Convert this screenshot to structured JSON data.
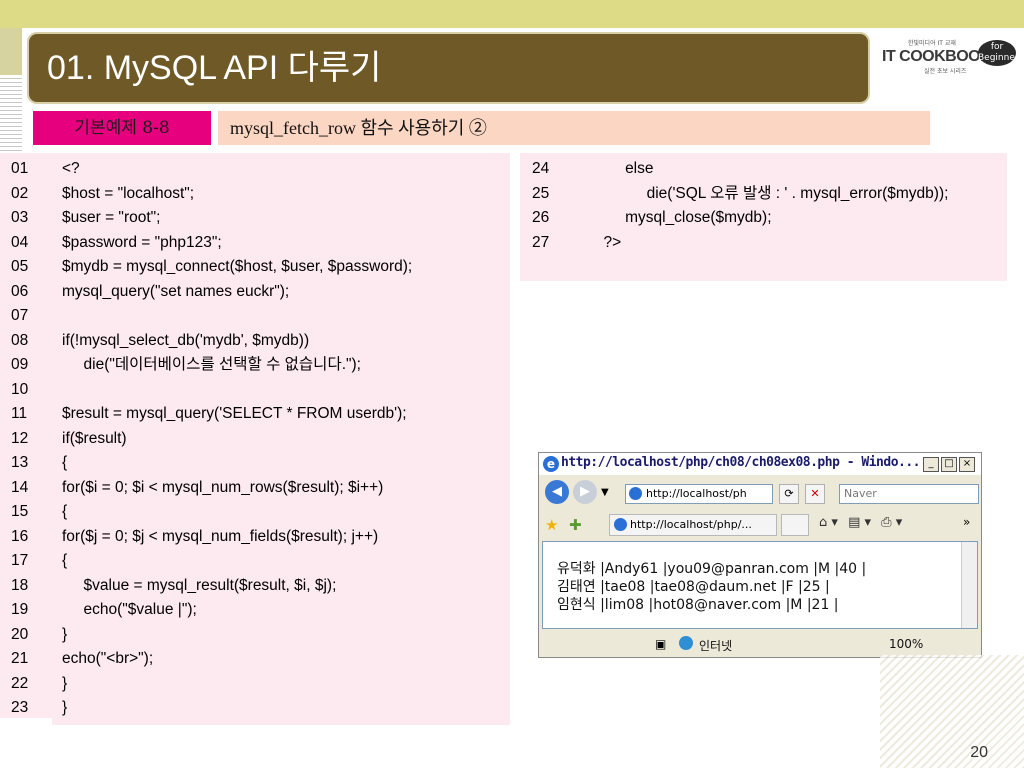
{
  "slide": {
    "title": "01.  MySQL API  다루기",
    "page_number": "20",
    "example_tag": "기본예제 8-8",
    "example_title": "mysql_fetch_row 함수 사용하기 ②"
  },
  "logo": {
    "main": "IT COOKBOOK",
    "small_top": "한빛미디어 IT 교재",
    "small_bottom": "실전 초보 시리즈",
    "badge": "for Beginner"
  },
  "code_left": [
    {
      "n": "01",
      "t": "<?"
    },
    {
      "n": "02",
      "t": "$host = \"localhost\";"
    },
    {
      "n": "03",
      "t": "$user = \"root\";"
    },
    {
      "n": "04",
      "t": "$password = \"php123\";"
    },
    {
      "n": "05",
      "t": "$mydb = mysql_connect($host, $user, $password);"
    },
    {
      "n": "06",
      "t": "mysql_query(\"set names euckr\");"
    },
    {
      "n": "07",
      "t": ""
    },
    {
      "n": "08",
      "t": "if(!mysql_select_db('mydb', $mydb))"
    },
    {
      "n": "09",
      "t": "     die(\"데이터베이스를 선택할 수 없습니다.\");"
    },
    {
      "n": "10",
      "t": ""
    },
    {
      "n": "11",
      "t": "$result = mysql_query('SELECT * FROM userdb');"
    },
    {
      "n": "12",
      "t": "if($result)"
    },
    {
      "n": "13",
      "t": "{"
    },
    {
      "n": "14",
      "t": "for($i = 0; $i < mysql_num_rows($result); $i++)"
    },
    {
      "n": "15",
      "t": "{"
    },
    {
      "n": "16",
      "t": "for($j = 0; $j < mysql_num_fields($result); j++)"
    },
    {
      "n": "17",
      "t": "{"
    },
    {
      "n": "18",
      "t": "     $value = mysql_result($result, $i, $j);"
    },
    {
      "n": "19",
      "t": "     echo(\"$value |\");"
    },
    {
      "n": "20",
      "t": "}"
    },
    {
      "n": "21",
      "t": "echo(\"<br>\");"
    },
    {
      "n": "22",
      "t": "}"
    },
    {
      "n": "23",
      "t": "}"
    }
  ],
  "code_right": [
    {
      "n": "24",
      "t": "          else"
    },
    {
      "n": "25",
      "t": "               die('SQL 오류 발생 : ' . mysql_error($mydb));"
    },
    {
      "n": "26",
      "t": "          mysql_close($mydb);"
    },
    {
      "n": "27",
      "t": "     ?>"
    }
  ],
  "browser": {
    "window_title": "http://localhost/php/ch08/ch08ex08.php - Windo...",
    "address": "http://localhost/ph",
    "search_placeholder": "Naver",
    "tab_label": "http://localhost/php/...",
    "output": [
      "유덕화 |Andy61 |you09@panran.com |M |40 |",
      "김태연 |tae08 |tae08@daum.net |F |25 |",
      "임현식 |lim08 |hot08@naver.com |M |21 |"
    ],
    "status_zone": "인터넷",
    "zoom": "100%",
    "minimize": "_",
    "maximize": "□",
    "close": "×",
    "chevron": "»"
  },
  "colors": {
    "title_bar": "#6f5a27",
    "example_tag": "#e6007e",
    "example_title_bg": "#fbd6c2",
    "code_bg": "#fde9f0",
    "top_band": "#dedb86"
  }
}
